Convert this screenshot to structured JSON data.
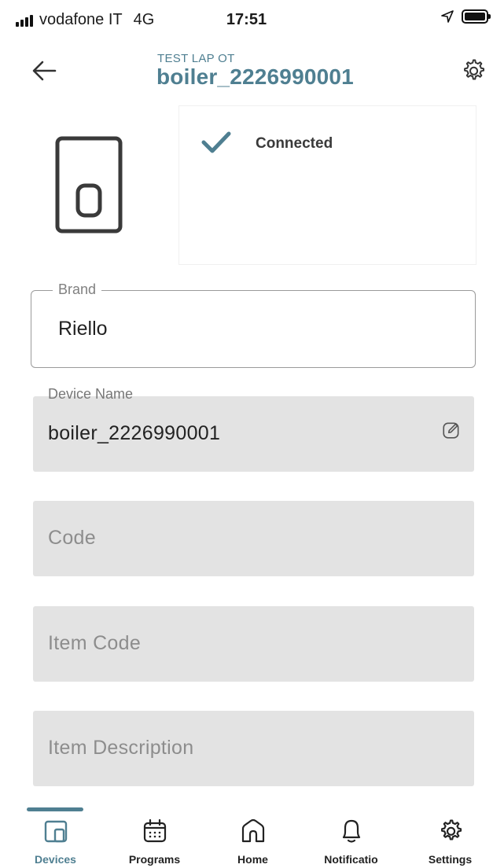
{
  "status_bar": {
    "carrier": "vodafone IT",
    "network": "4G",
    "time": "17:51"
  },
  "header": {
    "subtitle": "TEST LAP OT",
    "title": "boiler_2226990001"
  },
  "device": {
    "status": "Connected",
    "icon": "boiler-device-icon"
  },
  "fields": {
    "brand": {
      "label": "Brand",
      "value": "Riello"
    },
    "device_name": {
      "label": "Device Name",
      "value": "boiler_2226990001"
    },
    "code": {
      "placeholder": "Code"
    },
    "item_code": {
      "placeholder": "Item Code"
    },
    "item_description": {
      "placeholder": "Item Description"
    }
  },
  "bottom_nav": {
    "items": [
      {
        "label": "Devices",
        "icon": "devices-icon",
        "active": true
      },
      {
        "label": "Programs",
        "icon": "calendar-icon",
        "active": false
      },
      {
        "label": "Home",
        "icon": "home-icon",
        "active": false
      },
      {
        "label": "Notificatio",
        "icon": "bell-icon",
        "active": false
      },
      {
        "label": "Settings",
        "icon": "gear-icon",
        "active": false
      }
    ]
  },
  "colors": {
    "accent": "#4f7f91",
    "field_fill": "#e3e3e3",
    "text": "#1b1b1b"
  }
}
